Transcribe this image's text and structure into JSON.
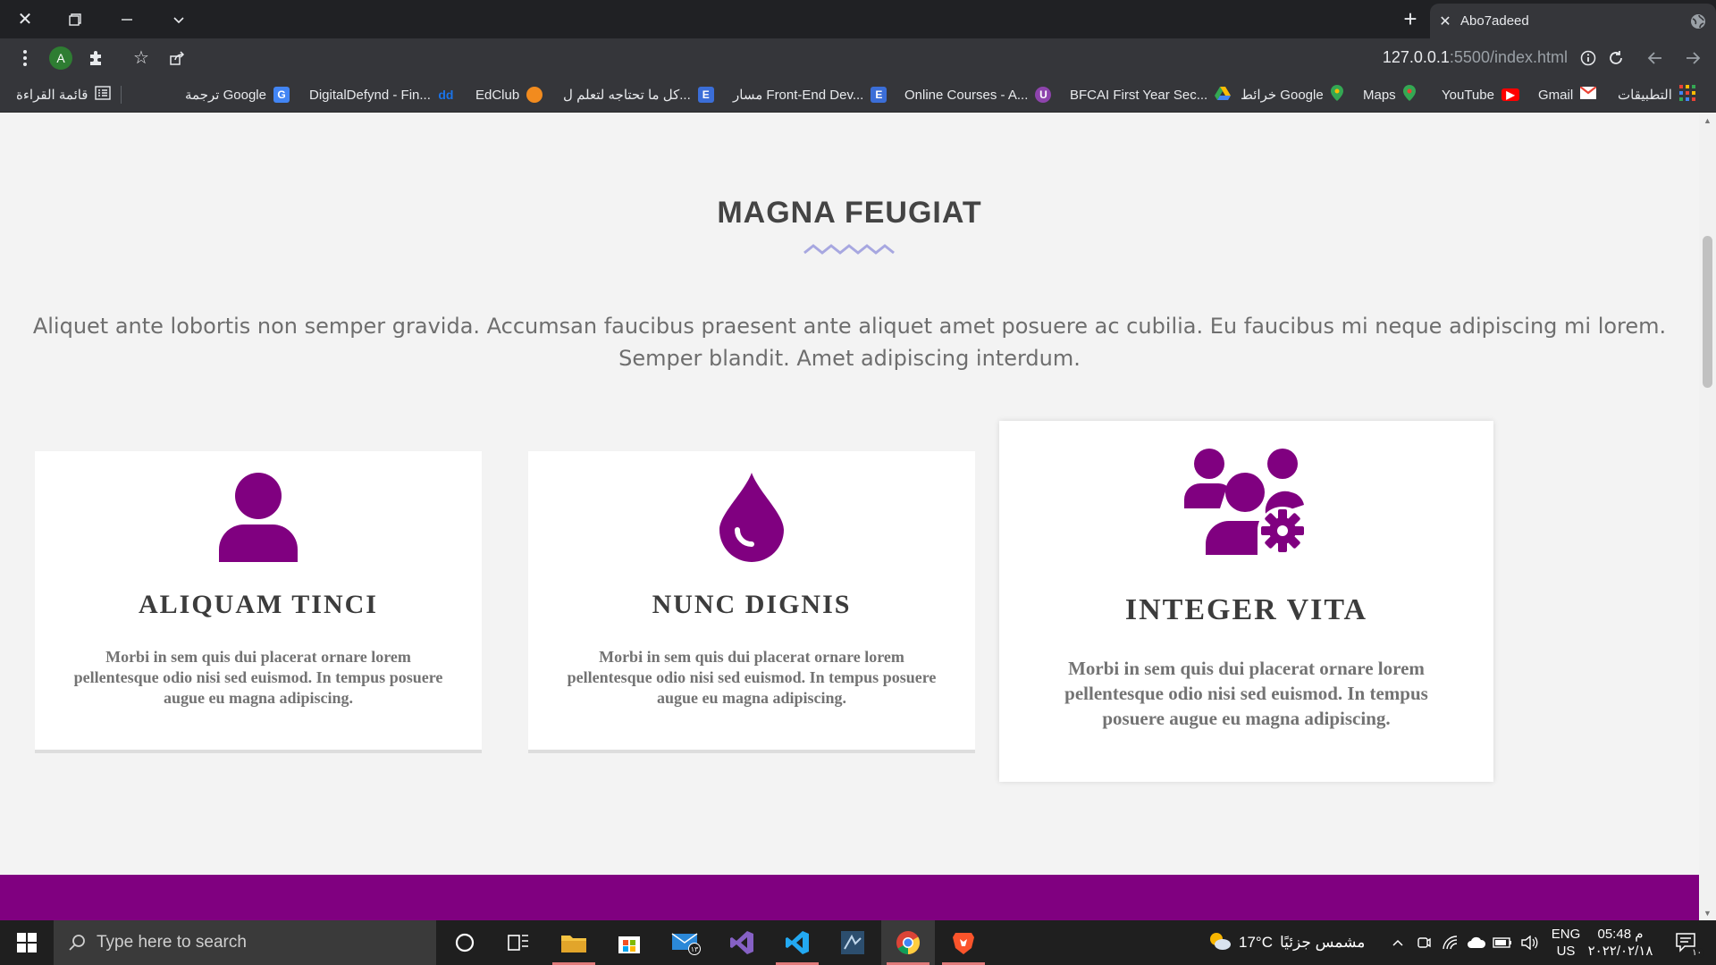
{
  "browser": {
    "tab_title": "Abo7adeed",
    "url_host": "127.0.0.1",
    "url_rest": ":5500/index.html",
    "profile_initial": "A",
    "bookmarks": [
      {
        "label": "التطبيقات",
        "icon": "apps-grid-icon"
      },
      {
        "label": "Gmail",
        "icon": "gmail-icon"
      },
      {
        "label": "YouTube",
        "icon": "youtube-icon"
      },
      {
        "label": "Maps",
        "icon": "maps-icon"
      },
      {
        "label": "خرائط Google",
        "icon": "maps-icon"
      },
      {
        "label": "BFCAI First Year Sec...",
        "icon": "drive-icon"
      },
      {
        "label": "Online Courses - A...",
        "icon": "udemy-icon"
      },
      {
        "label": "مسار Front-End Dev...",
        "icon": "e-icon"
      },
      {
        "label": "كل ما تحتاجه لتعلم ل...",
        "icon": "e-icon"
      },
      {
        "label": "EdClub",
        "icon": "edclub-icon"
      },
      {
        "label": "DigitalDefynd - Fin...",
        "icon": "dd-icon"
      },
      {
        "label": "ترجمة Google",
        "icon": "translate-icon"
      }
    ],
    "reading_list": "قائمة القراءة"
  },
  "page": {
    "section_title": "MAGNA FEUGIAT",
    "intro": "Aliquet ante lobortis non semper gravida. Accumsan faucibus praesent ante aliquet amet posuere ac cubilia. Eu faucibus mi neque adipiscing mi lorem. Semper blandit. Amet adipiscing interdum.",
    "accent_color": "#800080",
    "cards": [
      {
        "title": "ALIQUAM TINCI",
        "text": "Morbi in sem quis dui placerat ornare lorem pellentesque odio nisi sed euismod. In tempus posuere augue eu magna adipiscing.",
        "icon": "user-icon"
      },
      {
        "title": "NUNC DIGNIS",
        "text": "Morbi in sem quis dui placerat ornare lorem pellentesque odio nisi sed euismod. In tempus posuere augue eu magna adipiscing.",
        "icon": "droplet-icon"
      },
      {
        "title": "INTEGER VITA",
        "text": "Morbi in sem quis dui placerat ornare lorem pellentesque odio nisi sed euismod. In tempus posuere augue eu magna adipiscing.",
        "icon": "users-cog-icon"
      }
    ]
  },
  "taskbar": {
    "search_placeholder": "Type here to search",
    "weather_temp": "17°C",
    "weather_text": "مشمس جزئيًا",
    "lang": "ENG",
    "region": "US",
    "time": "05:48 م",
    "date": "٢٠٢٢/٠٢/١٨",
    "notification_count": "١٠"
  }
}
